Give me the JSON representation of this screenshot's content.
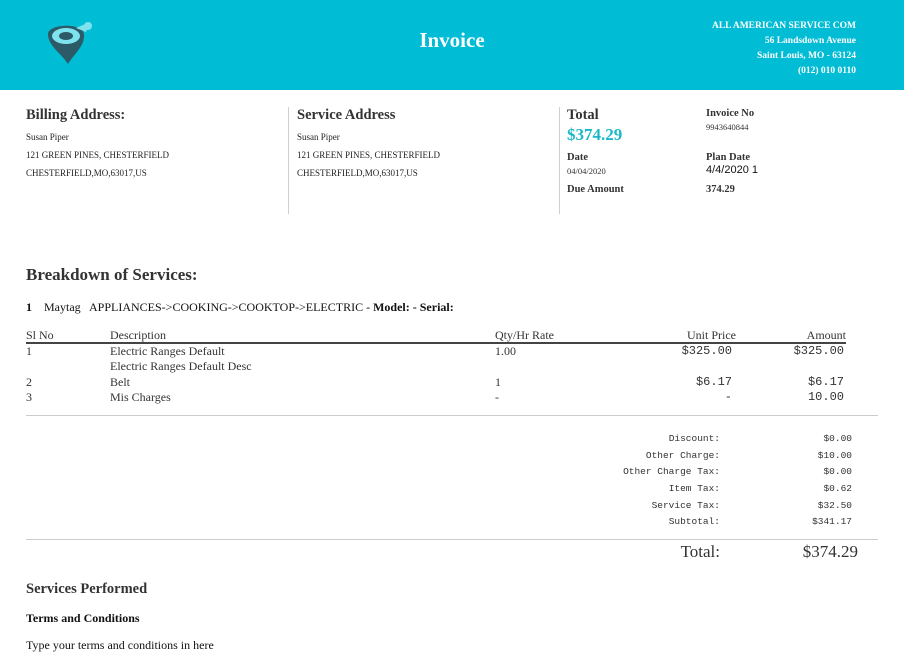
{
  "header": {
    "title": "Invoice",
    "company": {
      "name": "ALL AMERICAN SERVICE COM",
      "street": "56 Landsdown Avenue",
      "city": "Saint Louis, MO - 63124",
      "phone": "(012) 010 0110"
    },
    "logo_icon": "pin-logo-icon",
    "brand_color": "#00bcd4"
  },
  "billing": {
    "title": "Billing Address:",
    "name": "Susan Piper",
    "line1": "121 GREEN PINES, CHESTERFIELD",
    "line2": "CHESTERFIELD,MO,63017,US"
  },
  "service_address": {
    "title": "Service Address",
    "name": "Susan Piper",
    "line1": "121 GREEN PINES, CHESTERFIELD",
    "line2": "CHESTERFIELD,MO,63017,US"
  },
  "summary": {
    "total_label": "Total",
    "total_value": "$374.29",
    "invoice_no_label": "Invoice No",
    "invoice_no": "9943640844",
    "date_label": "Date",
    "date": "04/04/2020",
    "plan_date_label": "Plan Date",
    "plan_date": "4/4/2020 1",
    "due_label": "Due Amount",
    "due_value": "374.29"
  },
  "breakdown": {
    "title": "Breakdown of Services:",
    "appliance": {
      "index": "1",
      "brand": "Maytag",
      "category": "APPLIANCES->COOKING->COOKTOP->ELECTRIC - ",
      "model_label": "Model: - Serial:"
    },
    "columns": {
      "sl": "Sl No",
      "desc": "Description",
      "qty": "Qty/Hr Rate",
      "unit": "Unit Price",
      "amount": "Amount"
    },
    "rows": [
      {
        "sl": "1",
        "desc": "Electric Ranges Default",
        "desc2": "Electric Ranges Default Desc",
        "qty": "1.00",
        "unit": "$325.00",
        "amount": "$325.00"
      },
      {
        "sl": "2",
        "desc": "Belt",
        "qty": "1",
        "unit": "$6.17",
        "amount": "$6.17"
      },
      {
        "sl": "3",
        "desc": "Mis Charges",
        "qty": "-",
        "unit": "-",
        "amount": "10.00"
      }
    ]
  },
  "totals": {
    "discount_label": "Discount:",
    "discount": "$0.00",
    "other_charge_label": "Other Charge:",
    "other_charge": "$10.00",
    "other_charge_tax_label": "Other Charge Tax:",
    "other_charge_tax": "$0.00",
    "item_tax_label": "Item Tax:",
    "item_tax": "$0.62",
    "service_tax_label": "Service Tax:",
    "service_tax": "$32.50",
    "subtotal_label": "Subtotal:",
    "subtotal": "$341.17",
    "grand_label": "Total:",
    "grand": "$374.29"
  },
  "footer": {
    "services_performed": "Services Performed",
    "terms_title": "Terms and Conditions",
    "terms_text": "Type your terms and conditions in here"
  }
}
